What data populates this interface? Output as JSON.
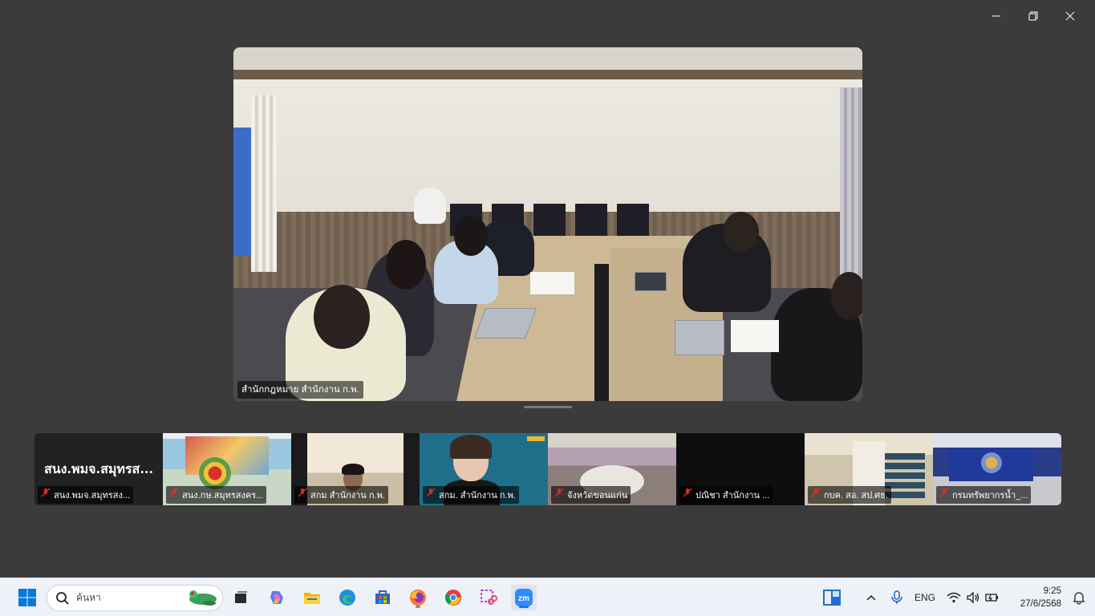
{
  "window": {
    "controls": [
      "minimize",
      "restore",
      "close"
    ]
  },
  "main_video": {
    "label": "สำนักกฎหมาย สำนักงาน ก.พ."
  },
  "thumbnails": [
    {
      "big_name": "สนง.พมจ.สมุทรส...",
      "label": "สนง.พมจ.สมุทรสง...",
      "mic": "muted"
    },
    {
      "label": "สนง.กษ.สมุทรสงคร...",
      "mic": "muted"
    },
    {
      "label": "สกม สำนักงาน ก.พ.",
      "mic": "muted"
    },
    {
      "label": "สกม. สำนักงาน ก.พ.",
      "mic": "muted"
    },
    {
      "label": "จังหวัดขอนแก่น",
      "mic": "muted"
    },
    {
      "label": "ปณิชา สำนักงาน ...",
      "mic": "muted"
    },
    {
      "label": "กบค. สอ. สป.ศธ.",
      "mic": "muted"
    },
    {
      "label": "กรมทรัพยากรน้ำ_...",
      "mic": "muted"
    }
  ],
  "taskbar": {
    "search_placeholder": "ค้นหา",
    "apps": [
      "start-icon",
      "task-view-icon",
      "copilot-icon",
      "file-explorer-icon",
      "edge-icon",
      "store-icon",
      "firefox-icon",
      "chrome-icon",
      "snipping-tool-icon",
      "zoom-icon"
    ],
    "language": "ENG",
    "time": "9:25",
    "date": "27/6/2568"
  },
  "colors": {
    "background": "#3b3b3b",
    "taskbar": "#eef1f7",
    "zoom_blue": "#2d8cff",
    "muted_red": "#e02828"
  }
}
